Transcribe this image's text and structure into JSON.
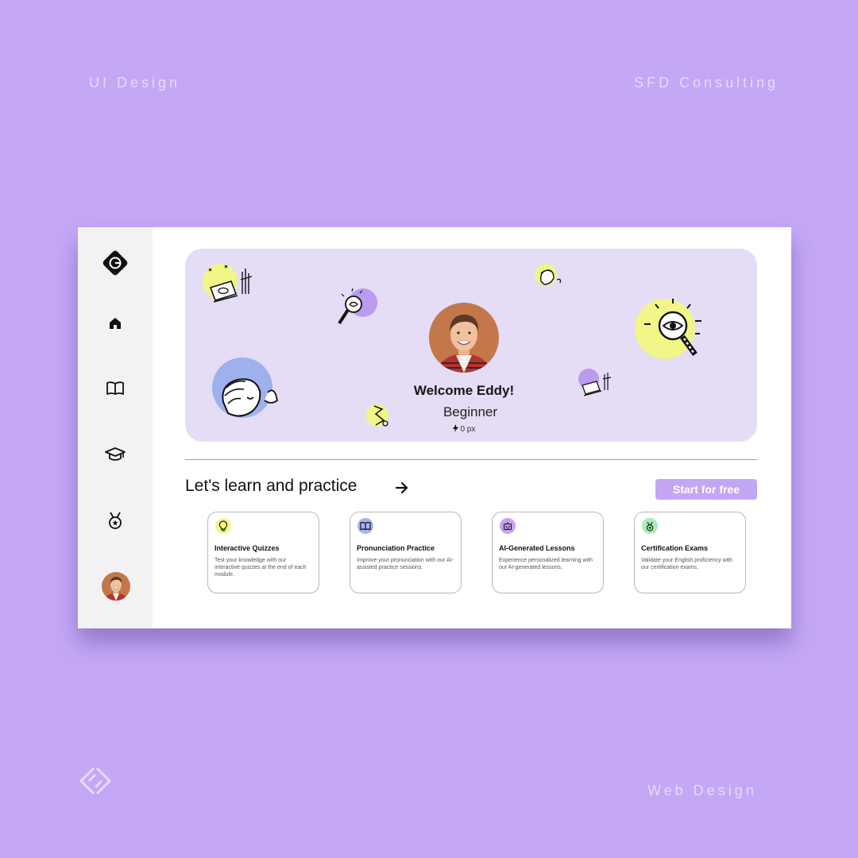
{
  "showcase": {
    "top_left": "UI Design",
    "top_right": "SFD Consulting",
    "bottom_right": "Web Design",
    "background_color": "#c4a8f6",
    "accent_color": "#c3a7f5"
  },
  "sidebar": {
    "logo_icon": "g-logo-icon",
    "items": [
      {
        "name": "home",
        "icon": "home-icon",
        "active": true
      },
      {
        "name": "lessons",
        "icon": "book-icon"
      },
      {
        "name": "courses",
        "icon": "graduation-cap-icon"
      },
      {
        "name": "achievements",
        "icon": "medal-icon"
      }
    ],
    "avatar_icon": "user-avatar"
  },
  "hero": {
    "welcome": "Welcome Eddy!",
    "level": "Beginner",
    "xp": "0 px",
    "background_color": "#e5dcf6"
  },
  "section": {
    "title": "Let's learn and practice",
    "cta": "Start for free"
  },
  "cards": [
    {
      "icon": "lightbulb-icon",
      "icon_color": "#f3f78a",
      "title": "Interactive Quizzes",
      "description": "Test your knowledge with our interactive quizzes at the end of each module."
    },
    {
      "icon": "book-icon",
      "icon_color": "#a9b4ee",
      "title": "Pronunciation Practice",
      "description": "Improve your pronunciation with our AI-assisted practice sessions."
    },
    {
      "icon": "robot-icon",
      "icon_color": "#c6a4f2",
      "title": "AI-Generated Lessons",
      "description": "Experience personalized learning with our AI-generated lessons."
    },
    {
      "icon": "medal-icon",
      "icon_color": "#a8eeb6",
      "title": "Certification Exams",
      "description": "Validate your English proficiency with our certification exams."
    }
  ]
}
